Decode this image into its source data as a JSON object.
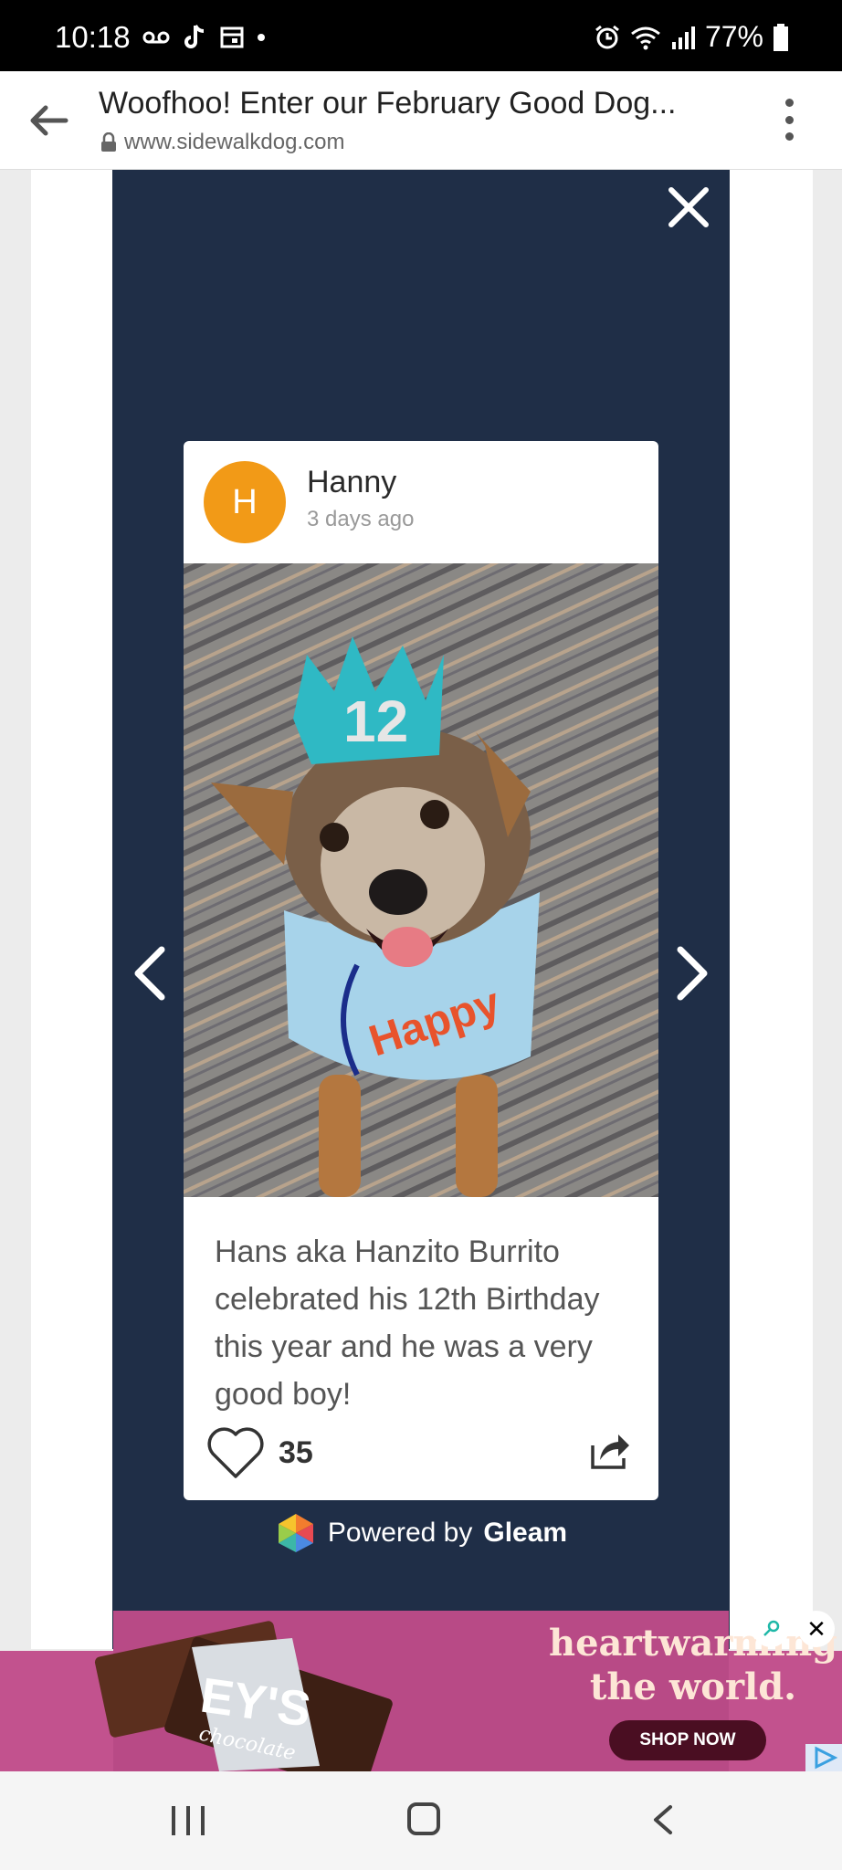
{
  "status_bar": {
    "time": "10:18",
    "battery": "77%"
  },
  "browser": {
    "title": "Woofhoo! Enter our February Good Dog...",
    "url": "www.sidewalkdog.com"
  },
  "post": {
    "avatar_letter": "H",
    "author": "Hanny",
    "time_ago": "3 days ago",
    "caption": "Hans aka Hanzito Burrito celebrated his 12th Birthday this year and he was a very good boy!",
    "likes": "35",
    "photo_crown_number": "12",
    "photo_bandana_text": "Happy"
  },
  "powered_by": {
    "prefix": "Powered by",
    "brand": "Gleam"
  },
  "ad": {
    "headline": "heartwarming the world.",
    "button": "SHOP NOW",
    "bar_brand": "EY'S",
    "bar_sub": "chocolate",
    "close": "✕"
  },
  "colors": {
    "modal": "#1f2e47",
    "avatar": "#f29a17",
    "ad": "#b84a86"
  }
}
